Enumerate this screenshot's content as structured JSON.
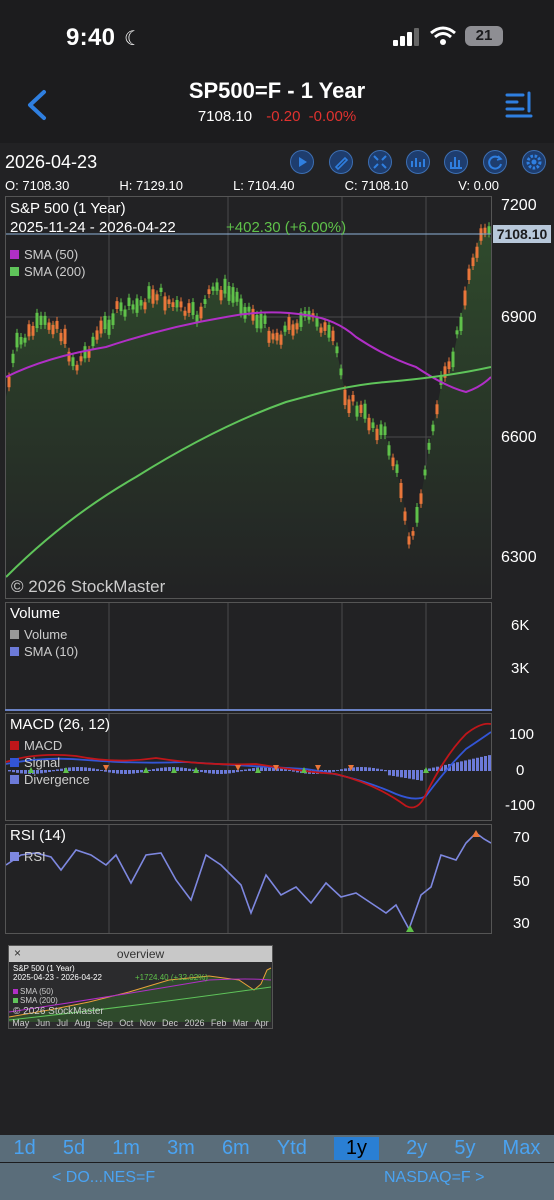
{
  "status_bar": {
    "time": "9:40",
    "battery": "21"
  },
  "header": {
    "title": "SP500=F - 1 Year",
    "price": "7108.10",
    "change": "-0.20",
    "change_pct": "-0.00%"
  },
  "chart": {
    "date": "2026-04-23",
    "ohlc": {
      "open": "O: 7108.30",
      "high": "H: 7129.10",
      "low": "L: 7104.40",
      "close": "C: 7108.10",
      "volume": "V: 0.00"
    },
    "main": {
      "name": "S&P 500 (1 Year)",
      "range": "2025-11-24 - 2026-04-22",
      "change": "+402.30 (+6.00%)",
      "legend": [
        "SMA (50)",
        "SMA (200)"
      ],
      "price_tag": "7108.10",
      "y_ticks": [
        "7200",
        "6900",
        "6600",
        "6300"
      ],
      "watermark": "© 2026 StockMaster"
    },
    "volume": {
      "name": "Volume",
      "legend": [
        "Volume",
        "SMA (10)"
      ],
      "y_ticks": [
        "6K",
        "3K"
      ]
    },
    "macd": {
      "name": "MACD (26, 12)",
      "legend": [
        "MACD",
        "Signal",
        "Divergence"
      ],
      "y_ticks": [
        "100",
        "0",
        "-100"
      ]
    },
    "rsi": {
      "name": "RSI (14)",
      "legend": [
        "RSI"
      ],
      "y_ticks": [
        "70",
        "50",
        "30"
      ]
    },
    "colors": {
      "up": "#5fc14a",
      "down": "#e9763a",
      "sma50": "#b02fc6",
      "sma200": "#5fc45a",
      "macd": "#c0161a",
      "signal": "#3355d6",
      "divergence": "#6c7ad8",
      "rsi": "#7e88e0"
    }
  },
  "overview": {
    "title": "overview",
    "close": "×",
    "name": "S&P 500 (1 Year)",
    "range": "2025-04-23 - 2026-04-22",
    "change": "+1724.40 (+32.02%)",
    "legend": [
      "SMA (50)",
      "SMA (200)"
    ],
    "watermark": "© 2026 StockMaster",
    "months": [
      "May",
      "Jun",
      "Jul",
      "Aug",
      "Sep",
      "Oct",
      "Nov",
      "Dec",
      "2026",
      "Feb",
      "Mar",
      "Apr"
    ]
  },
  "tabs": [
    "1d",
    "5d",
    "1m",
    "3m",
    "6m",
    "Ytd",
    "1y",
    "2y",
    "5y",
    "Max"
  ],
  "active_tab": "1y",
  "links": {
    "prev": "< DO...NES=F",
    "next": "NASDAQ=F >"
  }
}
